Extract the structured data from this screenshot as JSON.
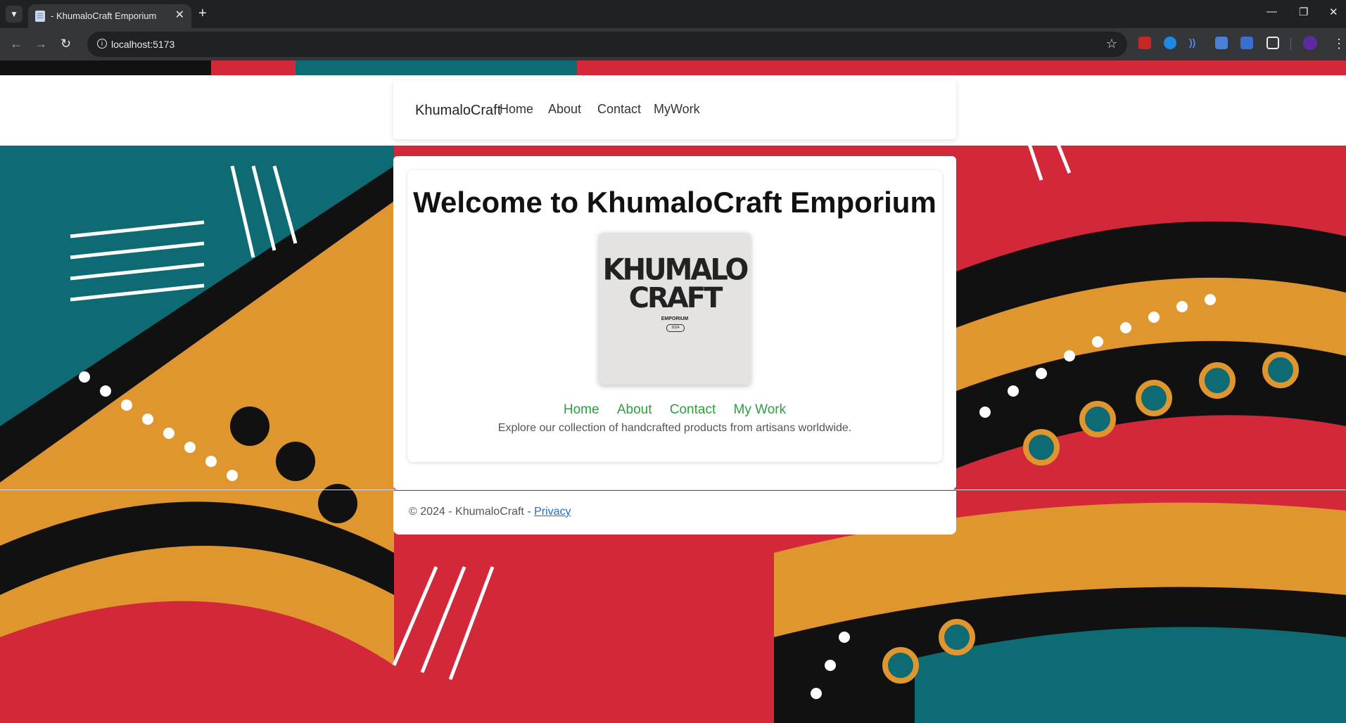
{
  "browser": {
    "tab_title": "- KhumaloCraft Emporium",
    "url": "localhost:5173"
  },
  "navbar": {
    "brand": "KhumaloCraft",
    "links": [
      "Home",
      "About",
      "Contact",
      "MyWork"
    ]
  },
  "hero": {
    "title": "Welcome to KhumaloCraft Emporium",
    "logo": {
      "line1": "KHUMALO",
      "line2": "CRAFT",
      "subtitle": "EMPORIUM",
      "year": "2024"
    },
    "links": [
      "Home",
      "About",
      "Contact",
      "My Work"
    ],
    "tagline": "Explore our collection of handcrafted products from artisans worldwide."
  },
  "footer": {
    "text": "© 2024 - KhumaloCraft - ",
    "link": "Privacy"
  },
  "colors": {
    "link_green": "#2e9e3e",
    "pattern_red": "#d2283a",
    "pattern_teal": "#0f6b73",
    "pattern_orange": "#e0962e"
  }
}
